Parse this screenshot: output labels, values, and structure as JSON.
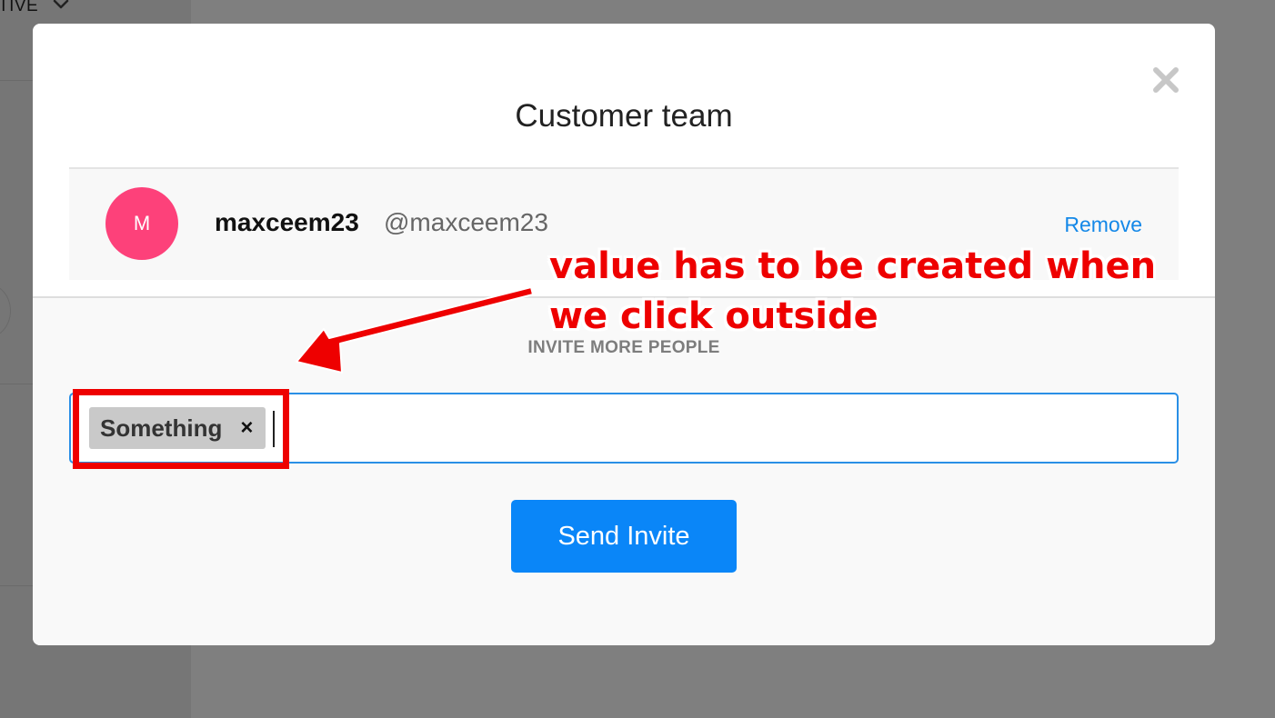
{
  "background": {
    "topbar_text": "TIVE"
  },
  "modal": {
    "title": "Customer team",
    "member": {
      "avatar_initial": "M",
      "name": "maxceem23",
      "handle": "@maxceem23",
      "remove_label": "Remove"
    },
    "invite": {
      "label": "INVITE MORE PEOPLE",
      "tags": [
        {
          "label": "Something",
          "remove_glyph": "×"
        }
      ],
      "send_label": "Send Invite"
    }
  },
  "annotation": {
    "lines": [
      "value has to be created when",
      "we click outside"
    ]
  },
  "colors": {
    "overlay": "#7f7f7f",
    "avatar": "#fd417a",
    "link": "#1488e8",
    "input_focus_border": "#2a8fe6",
    "primary_button": "#0a86f8",
    "annotation": "#ee0000"
  },
  "icons": {
    "close": "close-icon",
    "chevron": "chevron-down-icon",
    "arrow": "annotation-arrow"
  }
}
